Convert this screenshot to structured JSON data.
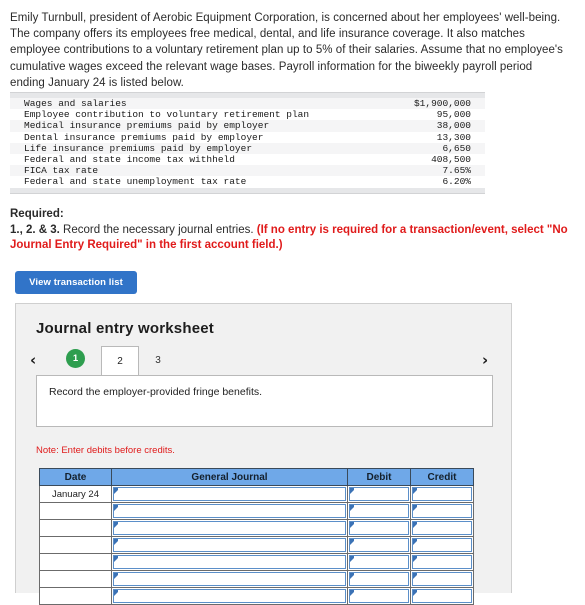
{
  "problem": {
    "text": "Emily Turnbull, president of Aerobic Equipment Corporation, is concerned about her employees' well-being. The company offers its employees free medical, dental, and life insurance coverage. It also matches employee contributions to a voluntary retirement plan up to 5% of their salaries. Assume that no employee's cumulative wages exceed the relevant wage bases. Payroll information for the biweekly payroll period ending January 24 is listed below."
  },
  "payroll_table": {
    "rows": [
      {
        "label": "Wages and salaries",
        "value": "$1,900,000"
      },
      {
        "label": "Employee contribution to voluntary retirement plan",
        "value": "95,000"
      },
      {
        "label": "Medical insurance premiums paid by employer",
        "value": "38,000"
      },
      {
        "label": "Dental insurance premiums paid by employer",
        "value": "13,300"
      },
      {
        "label": "Life insurance premiums paid by employer",
        "value": "6,650"
      },
      {
        "label": "Federal and state income tax withheld",
        "value": "408,500"
      },
      {
        "label": "FICA tax rate",
        "value": "7.65%"
      },
      {
        "label": "Federal and state unemployment tax rate",
        "value": "6.20%"
      }
    ]
  },
  "required": {
    "heading": "Required:",
    "item_number": "1., 2. & 3.",
    "item_text": " Record the necessary journal entries. ",
    "emphasis": "(If no entry is required for a transaction/event, select \"No Journal Entry Required\" in the first account field.)"
  },
  "toolbar": {
    "view_transaction_list": "View transaction list"
  },
  "worksheet": {
    "title": "Journal entry worksheet",
    "prev_arrow": "‹",
    "next_arrow": "›",
    "tabs": [
      {
        "label": "1",
        "state": "completed"
      },
      {
        "label": "2",
        "state": "active"
      },
      {
        "label": "3",
        "state": "inactive"
      }
    ],
    "instruction": "Record the employer-provided fringe benefits.",
    "note": "Note: Enter debits before credits.",
    "journal": {
      "columns": [
        "Date",
        "General Journal",
        "Debit",
        "Credit"
      ],
      "rows": [
        {
          "date": "January 24",
          "general_journal": "",
          "debit": "",
          "credit": ""
        },
        {
          "date": "",
          "general_journal": "",
          "debit": "",
          "credit": ""
        },
        {
          "date": "",
          "general_journal": "",
          "debit": "",
          "credit": ""
        },
        {
          "date": "",
          "general_journal": "",
          "debit": "",
          "credit": ""
        },
        {
          "date": "",
          "general_journal": "",
          "debit": "",
          "credit": ""
        },
        {
          "date": "",
          "general_journal": "",
          "debit": "",
          "credit": ""
        },
        {
          "date": "",
          "general_journal": "",
          "debit": "",
          "credit": ""
        }
      ]
    }
  },
  "colors": {
    "button_blue": "#3174c8",
    "tab_green": "#2e9e4f",
    "header_blue": "#6fa8e8",
    "alert_red": "#e01b1b"
  }
}
